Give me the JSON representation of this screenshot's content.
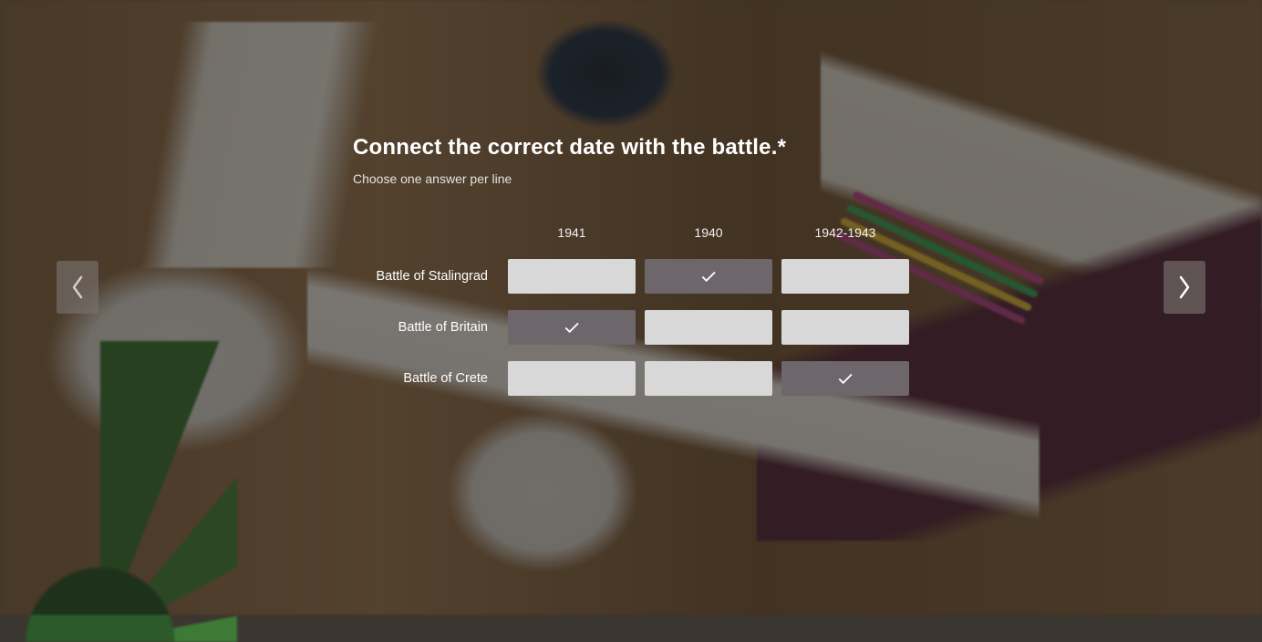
{
  "question": {
    "title": "Connect the correct date with the battle.*",
    "subtitle": "Choose one answer per line"
  },
  "matrix": {
    "columns": [
      "1941",
      "1940",
      "1942-1943"
    ],
    "rows": [
      {
        "label": "Battle of Stalingrad",
        "selected_col": 1
      },
      {
        "label": "Battle of Britain",
        "selected_col": 0
      },
      {
        "label": "Battle of Crete",
        "selected_col": 2
      }
    ]
  }
}
